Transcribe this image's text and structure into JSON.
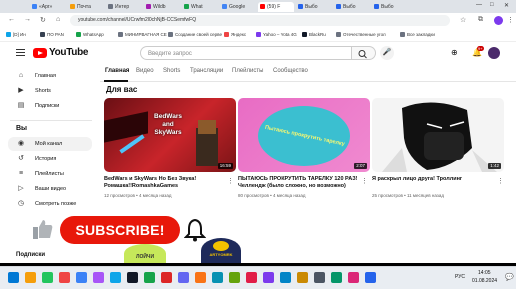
{
  "browser": {
    "tabs": [
      {
        "label": "«Apr»",
        "color": "#3b82f6"
      },
      {
        "label": "Почта",
        "color": "#f59e0b"
      },
      {
        "label": "Интер",
        "color": "#6b7280"
      },
      {
        "label": "Wildb",
        "color": "#a21caf"
      },
      {
        "label": "What",
        "color": "#16a34a"
      },
      {
        "label": "Google",
        "color": "#4285f4"
      },
      {
        "label": "(59) F",
        "color": "#ff0000"
      },
      {
        "label": "Выбо",
        "color": "#2563eb"
      },
      {
        "label": "Выбо",
        "color": "#2563eb"
      },
      {
        "label": "Выбо",
        "color": "#2563eb"
      }
    ],
    "url": "youtube.com/channel/UCrwfm2l0chNjB-CCSemfwFQ",
    "bookmarks": [
      {
        "label": "[D] Ин",
        "color": "#0ea5e9"
      },
      {
        "label": "ПО PAN",
        "color": "#374151"
      },
      {
        "label": "WhatsApp",
        "color": "#16a34a"
      },
      {
        "label": "МИНИРВАГНАЯ СЕ",
        "color": "#6b7280"
      },
      {
        "label": "Создание своей серве",
        "color": "#6b7280"
      },
      {
        "label": "Яндекс",
        "color": "#ef4444"
      },
      {
        "label": "Yahoo – Yota 4G",
        "color": "#7c3aed"
      },
      {
        "label": "BlackRu",
        "color": "#111827"
      },
      {
        "label": "Отечественные угол",
        "color": "#6b7280"
      },
      {
        "label": "Bce закладки",
        "color": "#6b7280"
      }
    ]
  },
  "youtube": {
    "brand": "YouTube",
    "search_placeholder": "Введите запрос",
    "sidebar": {
      "main": [
        {
          "label": "Главная",
          "icon": "home-icon"
        },
        {
          "label": "Shorts",
          "icon": "shorts-icon"
        },
        {
          "label": "Подписки",
          "icon": "subscriptions-icon"
        }
      ],
      "you_header": "Вы",
      "you": [
        {
          "label": "Мой канал",
          "icon": "channel-icon",
          "active": true
        },
        {
          "label": "История",
          "icon": "history-icon"
        },
        {
          "label": "Плейлисты",
          "icon": "playlist-icon"
        },
        {
          "label": "Ваши видео",
          "icon": "video-icon"
        },
        {
          "label": "Смотреть позже",
          "icon": "clock-icon"
        }
      ],
      "subs_header": "Подписки"
    },
    "channel_tabs": [
      "Главная",
      "Видео",
      "Shorts",
      "Трансляции",
      "Плейлисты",
      "Сообщество"
    ],
    "section_title": "Для вас",
    "videos": [
      {
        "title": "BedWars и SkyWars Но Без Звука! Ромашка!!RomashkaGames",
        "meta": "12 просмотров • 4 месяца назад",
        "duration": "16:59",
        "thumb_text": "BedWars and SkyWars"
      },
      {
        "title": "ПЫТАЮСЬ ПРОКРУТИТЬ ТАРЕЛКУ 120 РАЗ! Челлендж (было сложно, но возможно)",
        "meta": "80 просмотров • 4 месяца назад",
        "duration": "2:07",
        "thumb_text": "Пытаюсь прокрутить тарелку"
      },
      {
        "title": "Я раскрыл лицо друга! Троллинг",
        "meta": "25 просмотров • 11 месяцев назад",
        "duration": "1:42",
        "thumb_text": ""
      }
    ],
    "overlay": {
      "subscribe": "SUBSCRIBE!",
      "badge1": "ЛОЙЧИ",
      "badge2": "ARTYOMRK"
    }
  },
  "taskbar": {
    "time": "14:05",
    "date": "01.08.2024",
    "lang": "РУС",
    "colors": [
      "#0078d4",
      "#f59e0b",
      "#22c55e",
      "#ef4444",
      "#3b82f6",
      "#a855f7",
      "#0ea5e9",
      "#111827",
      "#16a34a",
      "#dc2626",
      "#6366f1",
      "#f97316",
      "#0891b2",
      "#65a30d",
      "#e11d48",
      "#7c3aed",
      "#0284c7",
      "#ca8a04",
      "#4b5563",
      "#059669",
      "#db2777",
      "#2563eb"
    ]
  }
}
